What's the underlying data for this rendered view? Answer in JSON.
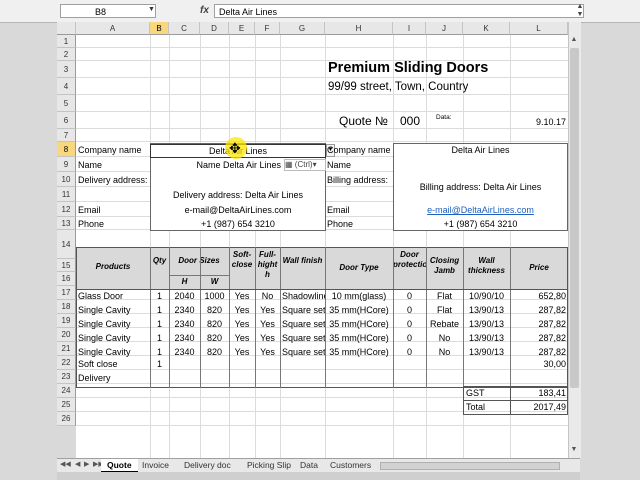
{
  "formula_bar": {
    "name_box": "B8",
    "fx_icon": "fx",
    "content": "Delta Air Lines"
  },
  "columns": [
    "A",
    "B",
    "C",
    "D",
    "E",
    "F",
    "G",
    "H",
    "I",
    "J",
    "K",
    "L"
  ],
  "rows": [
    "1",
    "2",
    "3",
    "4",
    "5",
    "6",
    "7",
    "8",
    "9",
    "10",
    "11",
    "12",
    "13",
    "14",
    "15",
    "16",
    "17",
    "18",
    "19",
    "20",
    "21",
    "22",
    "23",
    "24",
    "25",
    "26"
  ],
  "header": {
    "title": "Premium Sliding Doors",
    "address": "99/99 street, Town, Country",
    "quote_label": "Quote №",
    "quote_number": "000",
    "data_label": "Data:",
    "date": "9.10.17"
  },
  "left_info": {
    "company_label": "Company name",
    "company_value": "Delta Air Lines",
    "name_label": "Name",
    "name_value": "Name Delta Air Lines",
    "ctrl_label": "(Ctrl)",
    "delivery_label": "Delivery address:",
    "delivery_value": "Delivery address: Delta Air Lines",
    "email_label": "Email",
    "email_value": "e-mail@DeltaAirLines.com",
    "phone_label": "Phone",
    "phone_value": "+1 (987) 654 3210"
  },
  "right_info": {
    "company_label": "Company name",
    "company_value": "Delta Air Lines",
    "name_label": "Name",
    "billing_label": "Billing address:",
    "billing_value": "Billing address: Delta Air Lines",
    "email_label": "Email",
    "email_value": "e-mail@DeltaAirLines.com",
    "phone_label": "Phone",
    "phone_value": "+1 (987) 654 3210"
  },
  "table": {
    "headers": {
      "products": "Products",
      "qty": "Qty",
      "door_sizes": "Door Sizes",
      "h": "H",
      "w": "W",
      "soft_close": "Soft-close",
      "full_hight": "Full-hight h",
      "wall_finish": "Wall finish",
      "door_type": "Door Type",
      "door_protection": "Door protection",
      "closing_jamb": "Closing Jamb",
      "wall_thickness": "Wall thickness",
      "price": "Price"
    },
    "rows": [
      [
        "Glass Door",
        "1",
        "2040",
        "1000",
        "Yes",
        "No",
        "Shadowline",
        "10 mm(glass)",
        "0",
        "Flat",
        "10/90/10",
        "652,80"
      ],
      [
        "Single Cavity",
        "1",
        "2340",
        "820",
        "Yes",
        "Yes",
        "Square set",
        "35 mm(HCore)",
        "0",
        "Flat",
        "13/90/13",
        "287,82"
      ],
      [
        "Single Cavity",
        "1",
        "2340",
        "820",
        "Yes",
        "Yes",
        "Square set",
        "35 mm(HCore)",
        "0",
        "Rebate",
        "13/90/13",
        "287,82"
      ],
      [
        "Single Cavity",
        "1",
        "2340",
        "820",
        "Yes",
        "Yes",
        "Square set",
        "35 mm(HCore)",
        "0",
        "No",
        "13/90/13",
        "287,82"
      ],
      [
        "Single Cavity",
        "1",
        "2340",
        "820",
        "Yes",
        "Yes",
        "Square set",
        "35 mm(HCore)",
        "0",
        "No",
        "13/90/13",
        "287,82"
      ]
    ],
    "soft_close_label": "Soft close",
    "soft_close_qty": "1",
    "soft_close_price": "30,00",
    "delivery_label": "Delivery",
    "gst_label": "GST",
    "gst_value": "183,41",
    "total_label": "Total",
    "total_value": "2017,49"
  },
  "tabs": [
    "Quote",
    "Invoice",
    "Delivery doc",
    "Picking Slip",
    "Data",
    "Customers"
  ]
}
